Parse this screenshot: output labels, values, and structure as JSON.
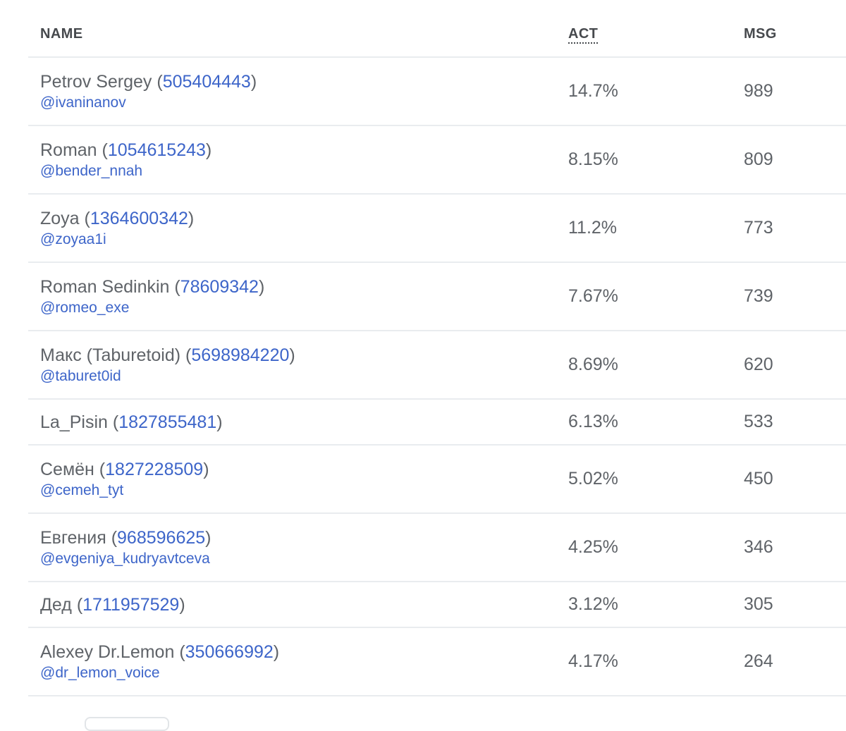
{
  "table": {
    "headers": {
      "name": "NAME",
      "act": "ACT",
      "msg": "MSG"
    },
    "rows": [
      {
        "name": "Petrov Sergey",
        "id": "505404443",
        "username": "@ivaninanov",
        "act": "14.7%",
        "msg": "989"
      },
      {
        "name": "Roman",
        "id": "1054615243",
        "username": "@bender_nnah",
        "act": "8.15%",
        "msg": "809"
      },
      {
        "name": "Zoya",
        "id": "1364600342",
        "username": "@zoyaa1i",
        "act": "11.2%",
        "msg": "773"
      },
      {
        "name": "Roman Sedinkin",
        "id": "78609342",
        "username": "@romeo_exe",
        "act": "7.67%",
        "msg": "739"
      },
      {
        "name": "Макс (Taburetoid)",
        "id": "5698984220",
        "username": "@taburet0id",
        "act": "8.69%",
        "msg": "620"
      },
      {
        "name": "La_Pisin",
        "id": "1827855481",
        "username": "",
        "act": "6.13%",
        "msg": "533"
      },
      {
        "name": "Семён",
        "id": "1827228509",
        "username": "@cemeh_tyt",
        "act": "5.02%",
        "msg": "450"
      },
      {
        "name": "Евгения",
        "id": "968596625",
        "username": "@evgeniya_kudryavtceva",
        "act": "4.25%",
        "msg": "346"
      },
      {
        "name": "Дед",
        "id": "1711957529",
        "username": "",
        "act": "3.12%",
        "msg": "305"
      },
      {
        "name": "Alexey Dr.Lemon",
        "id": "350666992",
        "username": "@dr_lemon_voice",
        "act": "4.17%",
        "msg": "264"
      }
    ]
  },
  "colors": {
    "link": "#3d65c9",
    "text": "#5f6368",
    "header_text": "#46494d",
    "divider": "#e9ecef"
  }
}
